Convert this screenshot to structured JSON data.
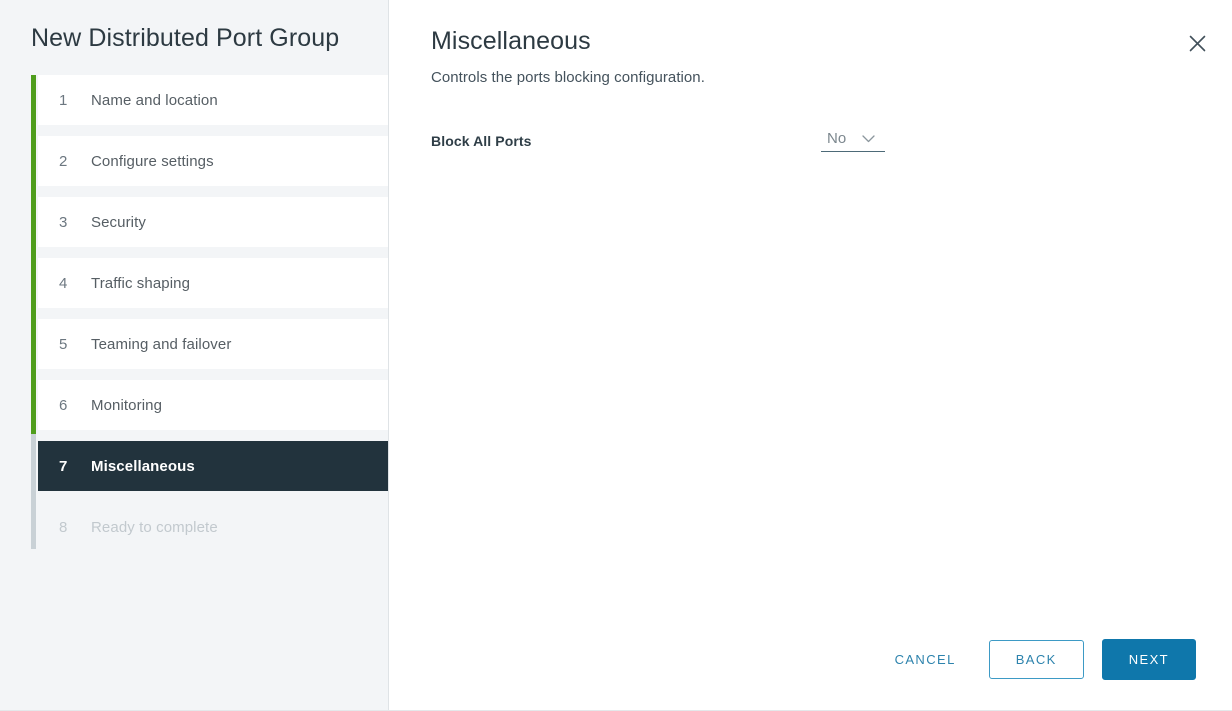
{
  "wizard": {
    "title": "New Distributed Port Group",
    "steps": [
      {
        "number": "1",
        "label": "Name and location",
        "state": "done"
      },
      {
        "number": "2",
        "label": "Configure settings",
        "state": "done"
      },
      {
        "number": "3",
        "label": "Security",
        "state": "done"
      },
      {
        "number": "4",
        "label": "Traffic shaping",
        "state": "done"
      },
      {
        "number": "5",
        "label": "Teaming and failover",
        "state": "done"
      },
      {
        "number": "6",
        "label": "Monitoring",
        "state": "done"
      },
      {
        "number": "7",
        "label": "Miscellaneous",
        "state": "active"
      },
      {
        "number": "8",
        "label": "Ready to complete",
        "state": "disabled"
      }
    ]
  },
  "content": {
    "title": "Miscellaneous",
    "subtitle": "Controls the ports blocking configuration.",
    "close_icon": "close-icon",
    "form": {
      "block_all_ports": {
        "label": "Block All Ports",
        "value": "No",
        "caret_icon": "chevron-down-icon"
      }
    }
  },
  "footer": {
    "cancel_label": "CANCEL",
    "back_label": "BACK",
    "next_label": "NEXT"
  },
  "colors": {
    "progress_done": "#4f9d1c",
    "progress_remaining": "#c9d1d6",
    "active_step_bg": "#22333d",
    "primary_button": "#0f77ab",
    "link_blue": "#2d83ad",
    "sidebar_bg": "#f3f5f7"
  }
}
